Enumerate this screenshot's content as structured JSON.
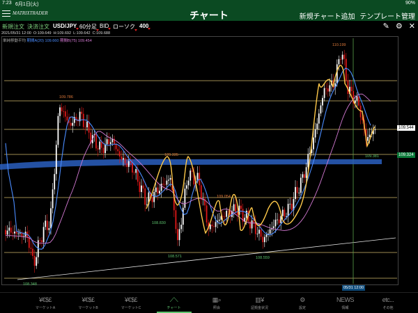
{
  "status": {
    "time": "7:23",
    "date": "6月1日(火)",
    "battery": "90%"
  },
  "header": {
    "logo": "MATRIXTRADER",
    "title": "チャート",
    "add_chart": "新規チャート追加",
    "template": "テンプレート管理"
  },
  "toolbar": {
    "new_order": "新規注文",
    "settle_order": "決済注文",
    "pair": "USD/JPY",
    "timeframe": "60分足",
    "bid": "BID",
    "chart_type": "ローソク",
    "count": "400"
  },
  "ohlc": {
    "datetime": "2021/05/31 12:00",
    "open": "O:109.649",
    "high": "H:109.692",
    "low": "L:109.642",
    "close": "C:109.688"
  },
  "ma_legend": {
    "title": "単純移動平均",
    "ma_a": "期間A(20) 109.660",
    "ma_b": "期間B(75) 109.454"
  },
  "annotations": [
    "110.199",
    "109.786",
    "109.335",
    "109.054",
    "108.830",
    "108.571",
    "108.559",
    "108.348",
    "109.381"
  ],
  "price_tags": {
    "current": "109.544",
    "band": "109.324"
  },
  "date_tag": "05/31 12:00",
  "colors": {
    "bg": "#000000",
    "header": "#0b4a22",
    "accent": "#5fc56f",
    "up_candle": "#ffffff",
    "down_candle": "#e01818",
    "ma_a": "#4a8cff",
    "ma_b": "#d47ad4",
    "wave_line": "#ffc94a",
    "hline": "#d2b86a",
    "band": "#2a5fc0"
  },
  "tabs": [
    {
      "label": "マーケットA",
      "icon": "¥€$£"
    },
    {
      "label": "マーケットB",
      "icon": "¥€$£"
    },
    {
      "label": "マーケットC",
      "icon": "¥€$£"
    },
    {
      "label": "チャート",
      "icon": "chart-icon"
    },
    {
      "label": "照会",
      "icon": "search-icon"
    },
    {
      "label": "証拠金状況",
      "icon": "margin-icon"
    },
    {
      "label": "設定",
      "icon": "gear-icon"
    },
    {
      "label": "情報",
      "icon": "news-icon"
    },
    {
      "label": "その他",
      "icon": "etc..."
    }
  ]
}
